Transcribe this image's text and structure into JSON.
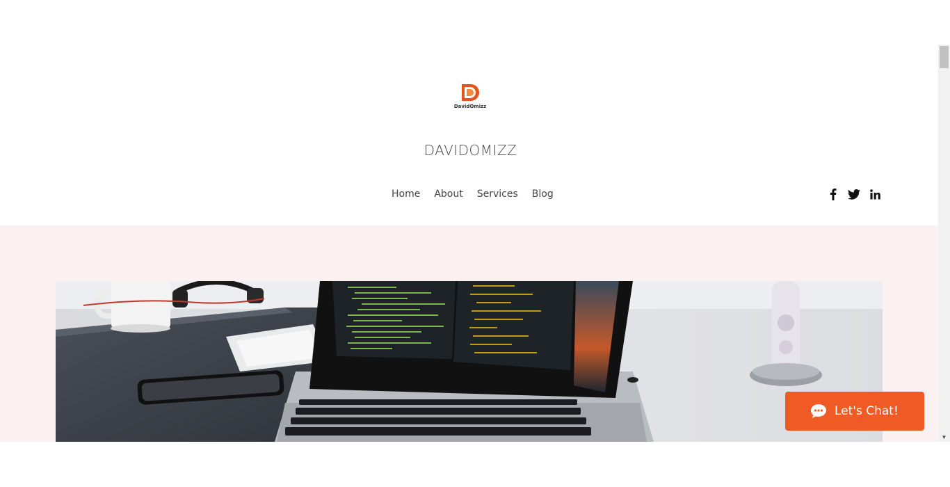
{
  "site": {
    "logo_text": "DavidOmizz",
    "logo_letter": "D",
    "title": "DAVIDOMIZZ"
  },
  "nav": {
    "items": [
      {
        "label": "Home"
      },
      {
        "label": "About"
      },
      {
        "label": "Services"
      },
      {
        "label": "Blog"
      }
    ]
  },
  "social": {
    "icons": [
      "facebook-icon",
      "twitter-icon",
      "linkedin-icon"
    ]
  },
  "hero": {
    "image_alt": "laptop-on-desk-image"
  },
  "chat": {
    "label": "Let's Chat!",
    "color": "#f05a24"
  },
  "colors": {
    "hero_bg": "#fbf1f1",
    "accent": "#f05a24",
    "text": "#444444"
  }
}
